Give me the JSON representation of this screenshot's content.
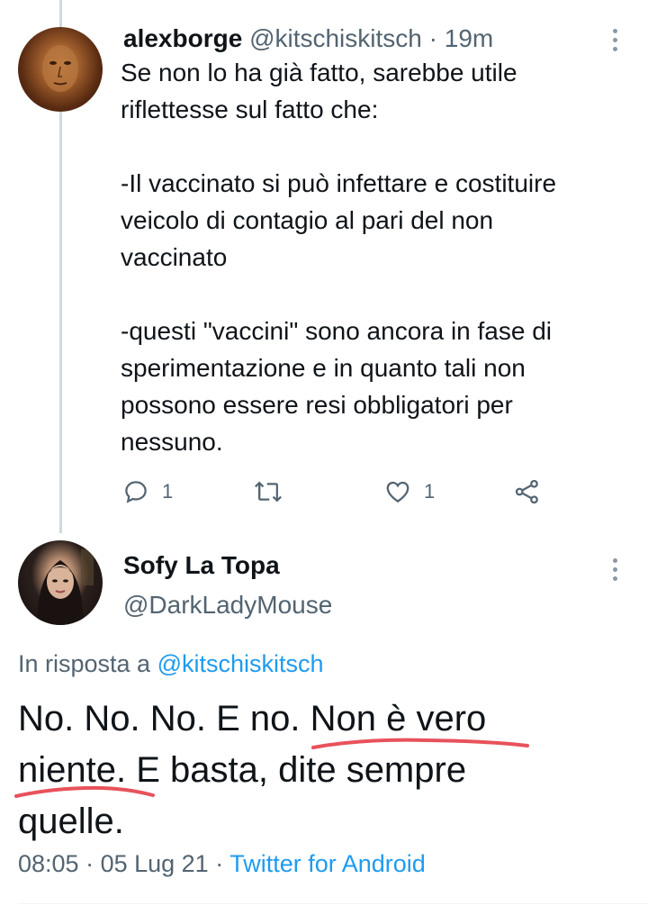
{
  "tweet1": {
    "author_name": "alexborge",
    "handle": "@kitschiskitsch",
    "separator": " · ",
    "time": "19m",
    "text": "Se non lo ha già fatto, sarebbe utile\nriflettesse sul fatto che:\n\n-Il vaccinato si può infettare e costituire\nveicolo di contagio al pari del non\nvaccinato\n\n-questi \"vaccini\" sono ancora in fase di\nsperimentazione e in quanto tali non\npossono essere resi obbligatori per\nnessuno.",
    "reply_count": "1",
    "like_count": "1"
  },
  "tweet2": {
    "author_name": "Sofy La Topa",
    "handle": "@DarkLadyMouse",
    "reply_prefix": "In risposta a ",
    "reply_handle": "@kitschiskitsch",
    "text": "No. No. No. E no. Non è vero niente. E basta, dite sempre quelle.",
    "time": "08:05",
    "date": "05 Lug 21",
    "sep1": " · ",
    "sep2": " · ",
    "client": "Twitter for Android"
  },
  "colors": {
    "link": "#1d9bf0",
    "muted": "#536471",
    "thread_line": "#cfd9de",
    "annotation_red": "#e8525b"
  },
  "icons": [
    "more-vertical-icon",
    "reply-icon",
    "retweet-icon",
    "like-icon",
    "share-icon"
  ]
}
